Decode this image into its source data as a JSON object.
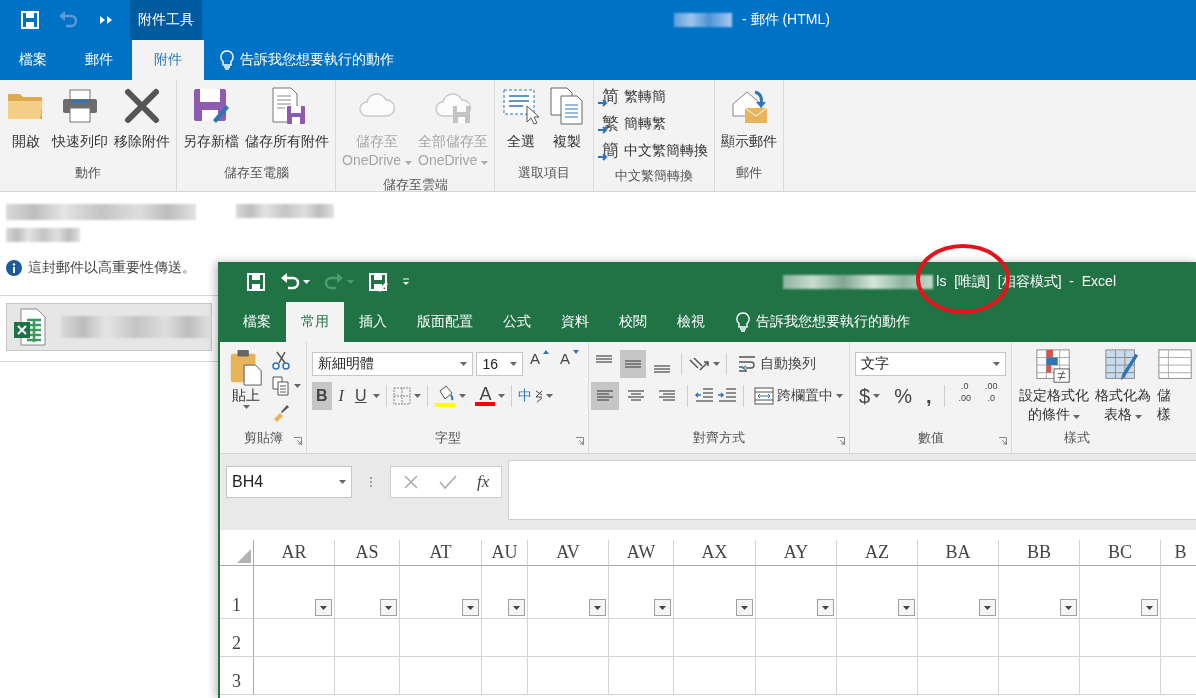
{
  "outlook": {
    "quick_access": [
      {
        "disabled": false
      },
      {
        "disabled": true
      },
      {
        "disabled": false
      }
    ],
    "contextual_tab": "附件工具",
    "title": "-  郵件 (HTML)",
    "tabs": [
      {
        "label": "檔案",
        "selected": false
      },
      {
        "label": "郵件",
        "selected": false
      },
      {
        "label": "附件",
        "selected": true
      }
    ],
    "tell_me": "告訴我您想要執行的動作",
    "ribbon_groups": [
      {
        "label": "動作",
        "items": [
          {
            "kind": "large",
            "lines": [
              "開啟"
            ],
            "disabled": false,
            "dropdown": false
          },
          {
            "kind": "large",
            "lines": [
              "快速列印"
            ],
            "disabled": false,
            "dropdown": false
          },
          {
            "kind": "large",
            "lines": [
              "移除附件"
            ],
            "disabled": false,
            "dropdown": false
          }
        ]
      },
      {
        "label": "儲存至電腦",
        "items": [
          {
            "kind": "large",
            "lines": [
              "另存新檔"
            ],
            "disabled": false,
            "dropdown": false
          },
          {
            "kind": "large",
            "lines": [
              "儲存所有附件"
            ],
            "disabled": false,
            "dropdown": false
          }
        ]
      },
      {
        "label": "儲存至雲端",
        "items": [
          {
            "kind": "large",
            "lines": [
              "儲存至",
              "OneDrive"
            ],
            "disabled": true,
            "dropdown": true
          },
          {
            "kind": "large",
            "lines": [
              "全部儲存至",
              "OneDrive"
            ],
            "disabled": true,
            "dropdown": true
          }
        ]
      },
      {
        "label": "選取項目",
        "items": [
          {
            "kind": "large",
            "lines": [
              "全選"
            ],
            "disabled": false,
            "dropdown": false
          },
          {
            "kind": "large",
            "lines": [
              "複製"
            ],
            "disabled": false,
            "dropdown": false
          }
        ]
      },
      {
        "label": "中文繁簡轉換",
        "items": [
          {
            "kind": "small",
            "glyph": "简",
            "lines": [
              "繁轉簡"
            ],
            "disabled": false,
            "dropdown": false
          },
          {
            "kind": "small",
            "glyph": "繁",
            "lines": [
              "簡轉繁"
            ],
            "disabled": false,
            "dropdown": false
          },
          {
            "kind": "small",
            "glyph": "簡",
            "lines": [
              "中文繁簡轉換"
            ],
            "disabled": false,
            "dropdown": false
          }
        ]
      },
      {
        "label": "郵件",
        "items": [
          {
            "kind": "large",
            "lines": [
              "顯示郵件"
            ],
            "disabled": false,
            "dropdown": false
          }
        ]
      }
    ],
    "info_message": "這封郵件以高重要性傳送。"
  },
  "excel": {
    "quick_access": [
      {
        "disabled": false
      },
      {
        "disabled": false
      },
      {
        "disabled": true
      },
      {
        "disabled": false
      }
    ],
    "title": "ls  [唯讀]  [相容模式]  -  Excel",
    "tabs": [
      {
        "label": "檔案",
        "selected": false
      },
      {
        "label": "常用",
        "selected": true
      },
      {
        "label": "插入",
        "selected": false
      },
      {
        "label": "版面配置",
        "selected": false
      },
      {
        "label": "公式",
        "selected": false
      },
      {
        "label": "資料",
        "selected": false
      },
      {
        "label": "校閱",
        "selected": false
      },
      {
        "label": "檢視",
        "selected": false
      }
    ],
    "tell_me": "告訴我您想要執行的動作",
    "paste": "貼上",
    "font_name": "新細明體",
    "font_size": "16",
    "font_size_buttons": [
      "A",
      "A"
    ],
    "font_styles": [
      {
        "label": "B",
        "selected": true
      },
      {
        "label": "I",
        "selected": false
      },
      {
        "label": "U",
        "selected": false
      }
    ],
    "font_color_label": "A",
    "phonetic_label": "中",
    "vertical_align": [
      {
        "selected": false
      },
      {
        "selected": true
      },
      {
        "selected": false
      }
    ],
    "horizontal_align": [
      {
        "selected": true
      },
      {
        "selected": false
      },
      {
        "selected": false
      }
    ],
    "wrap_text": "自動換列",
    "merge_center": "跨欄置中",
    "number_format": "文字",
    "number_symbols": [
      "$",
      "%",
      ","
    ],
    "decimal_buttons": [
      [
        ".0",
        ".00"
      ],
      [
        ".00",
        ".0"
      ]
    ],
    "conditional_format": [
      "設定格式化",
      "的條件"
    ],
    "format_table": [
      "格式化為",
      "表格"
    ],
    "cell_styles": [
      "儲",
      "樣"
    ],
    "group_labels": [
      "剪貼簿",
      "字型",
      "對齊方式",
      "數值",
      "樣式"
    ],
    "name_box": "BH4",
    "formula_label": "fx",
    "columns": [
      {
        "label": "AR",
        "filter": true
      },
      {
        "label": "AS",
        "filter": true
      },
      {
        "label": "AT",
        "filter": true
      },
      {
        "label": "AU",
        "filter": true
      },
      {
        "label": "AV",
        "filter": true
      },
      {
        "label": "AW",
        "filter": true
      },
      {
        "label": "AX",
        "filter": true
      },
      {
        "label": "AY",
        "filter": true
      },
      {
        "label": "AZ",
        "filter": true
      },
      {
        "label": "BA",
        "filter": true
      },
      {
        "label": "BB",
        "filter": true
      },
      {
        "label": "BC",
        "filter": true
      },
      {
        "label": "B",
        "filter": false
      }
    ],
    "rows": [
      "1",
      "2",
      "3"
    ]
  }
}
